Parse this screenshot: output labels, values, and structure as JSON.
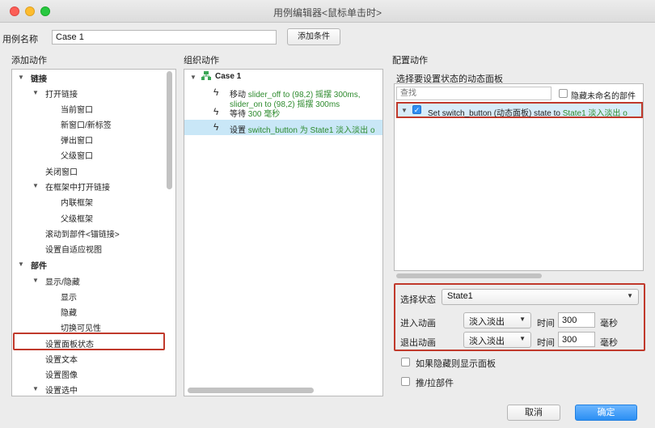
{
  "window": {
    "title": "用例编辑器<鼠标单击时>"
  },
  "case": {
    "name_label": "用例名称",
    "name_value": "Case 1",
    "add_condition": "添加条件"
  },
  "sections": {
    "add_action": "添加动作",
    "organize_action": "组织动作",
    "configure_action": "配置动作"
  },
  "add_actions": {
    "link": "链接",
    "open_link": "打开链接",
    "current_window": "当前窗口",
    "new_window": "新窗口/新标签",
    "popup_window": "弹出窗口",
    "parent_window": "父级窗口",
    "close_window": "关闭窗口",
    "open_in_frame": "在框架中打开链接",
    "inline_frame": "内联框架",
    "parent_frame": "父级框架",
    "scroll_to": "滚动到部件<锚链接>",
    "adaptive_view": "设置自适应视图",
    "widget": "部件",
    "show_hide": "显示/隐藏",
    "show": "显示",
    "hide": "隐藏",
    "toggle": "切换可见性",
    "set_panel_state": "设置面板状态",
    "set_text": "设置文本",
    "set_image": "设置图像",
    "set_selected": "设置选中"
  },
  "organize": {
    "case": "Case 1",
    "move_prefix": "移动",
    "move_detail_1": "slider_off to (98,2) 摇摆 300ms,",
    "move_detail_2": "slider_on to (98,2) 摇摆 300ms",
    "wait_prefix": "等待",
    "wait_detail": "300 毫秒",
    "set_prefix": "设置",
    "set_detail": "switch_button 为 State1 淡入淡出 o"
  },
  "configure": {
    "select_panel_label": "选择要设置状态的动态面板",
    "search_placeholder": "查找",
    "hide_unnamed": "隐藏未命名的部件",
    "item_prefix": "Set switch_button (动态面板) state to",
    "item_state": "State1 淡入淡出 o",
    "choose_state_label": "选择状态",
    "state_value": "State1",
    "enter_anim_label": "进入动画",
    "enter_anim_value": "淡入淡出",
    "time_label": "时间",
    "enter_time": "300",
    "ms": "毫秒",
    "exit_anim_label": "退出动画",
    "exit_anim_value": "淡入淡出",
    "exit_time": "300",
    "show_if_hidden": "如果隐藏则显示面板",
    "push_pull": "推/拉部件"
  },
  "footer": {
    "cancel": "取消",
    "ok": "确定"
  },
  "colors": {
    "accent": "#2b8ff3",
    "highlight": "#c0392b",
    "selection": "#c9e7f7",
    "action_text": "#2e8b2e"
  }
}
